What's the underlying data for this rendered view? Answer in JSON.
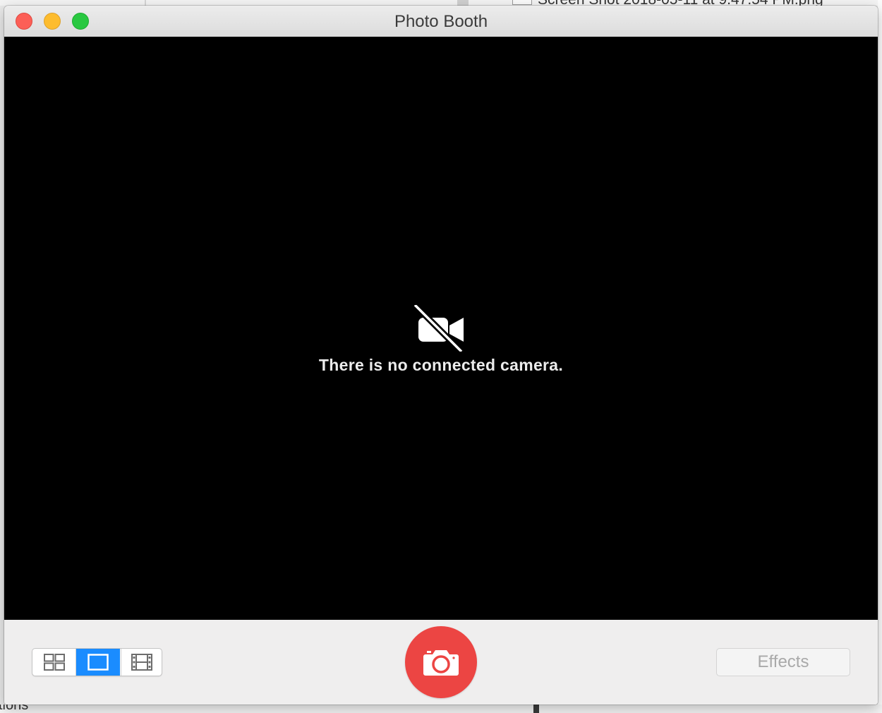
{
  "background": {
    "filename_fragment": "Screen Shot 2018-05-11 at 9.47.54 PM.png",
    "bottom_text_fragment": "tions"
  },
  "window": {
    "title": "Photo Booth",
    "traffic_lights": {
      "close_color": "#fc5f57",
      "minimize_color": "#fdbc2e",
      "zoom_color": "#29c841"
    }
  },
  "viewport": {
    "icon": "video-camera-slash-icon",
    "message": "There is no connected camera."
  },
  "toolbar": {
    "layout_modes": [
      {
        "icon": "four-up-grid-icon",
        "selected": false
      },
      {
        "icon": "single-photo-icon",
        "selected": true
      },
      {
        "icon": "movie-film-icon",
        "selected": false
      }
    ],
    "shutter_icon": "camera-icon",
    "shutter_color": "#ec4543",
    "selected_color": "#1a8cff",
    "effects_label": "Effects"
  }
}
